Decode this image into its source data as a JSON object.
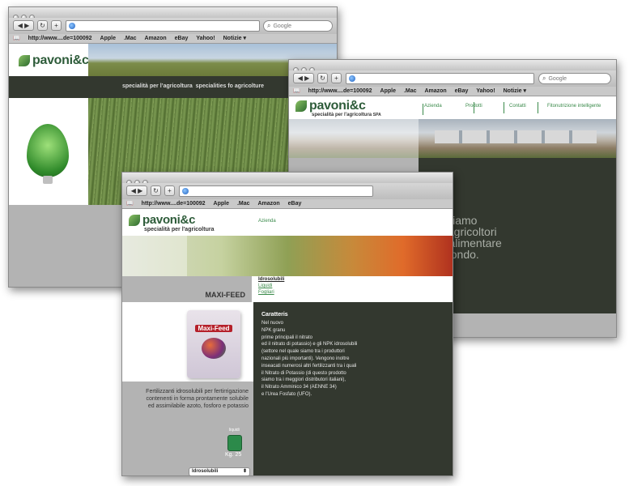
{
  "browser": {
    "url_text": "http://www....de=100092",
    "search_placeholder": "Google",
    "bookmarks": [
      "Apple",
      ".Mac",
      "Amazon",
      "eBay",
      "Yahoo!",
      "Notizie ▾"
    ],
    "book_icon": "📖"
  },
  "window_back": {
    "brand": "pavoni&c",
    "banner_text": "specialità per l’agricoltura  specialities fo agricolture"
  },
  "window_front": {
    "brand": "pavoni&c",
    "tagline": "specialità per l'agricoltura",
    "nav_first": "Azienda",
    "product_title": "MAXI-FEED",
    "submenu": [
      "Idrosolubili",
      "Liquidi",
      "Fogliari"
    ],
    "bag_label": "Maxi-Feed",
    "description": "Fertilizzanti idrosolubili per fertirrigazione contenenti in forma prontamente solubile ed assimilabile azoto, fosforo e potassio",
    "pack_label": "Kg. 25",
    "pack_caption": "liquidi",
    "select_value": "Idrosolubili",
    "panel_heading": "Caratteris",
    "panel_lines": [
      "Nel nuovo",
      "NPK granu",
      "prime principali il nitrato",
      "ed il nitrato di potassio) e gli NPK idrosolubili",
      "(settore nel quale siamo tra i produttori",
      "nazionali più importanti). Vengono inoltre",
      "inseacati numerosi altri fertilizzanti tra i quali",
      "il Nitrato di Potassio (di questo prodotto",
      "siamo tra i meggiori distributori italiani),",
      "il Nitrato Amminico 34 (AENNE 34)",
      "e l'Urea Fosfato (UFO)."
    ]
  },
  "window_right": {
    "brand": "pavoni&c",
    "tagline": "specialità per l'agricoltura",
    "tagline_suffix": "SPA",
    "nav": [
      "Azienda",
      "Prodotti",
      "Contatti",
      "Fitonutrizione intelligente"
    ],
    "headline": [
      "Ajutiamo",
      "gli agricoltori",
      "ad alimentare",
      "il mondo."
    ]
  },
  "colors": {
    "dark_green": "#33382f",
    "gray_panel": "#b3b3b3",
    "brand_green": "#2e5c3a",
    "nav_green": "#3a8a4a"
  }
}
